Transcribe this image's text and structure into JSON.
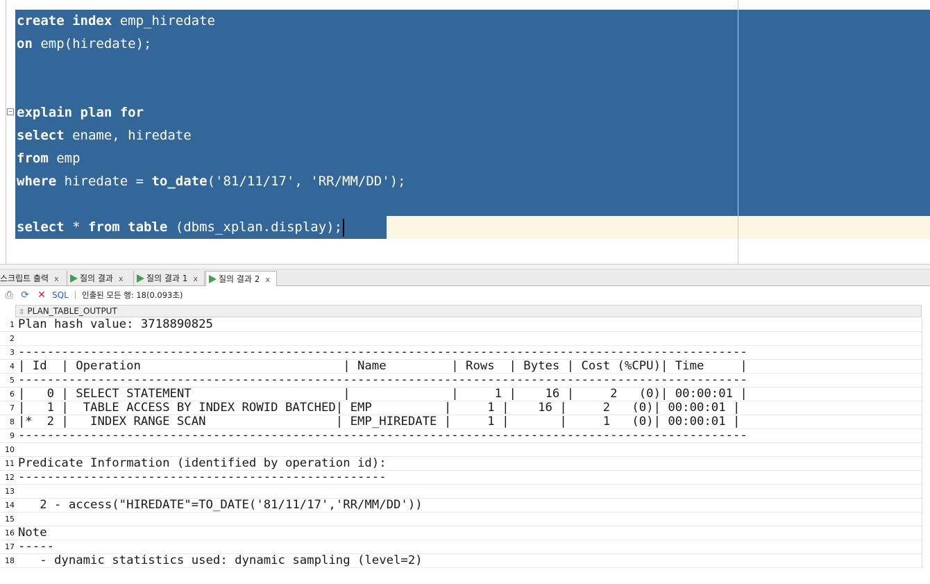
{
  "editor": {
    "lines": [
      [
        {
          "t": "create index",
          "k": true
        },
        {
          "t": " emp_hiredate",
          "k": false
        }
      ],
      [
        {
          "t": "on",
          "k": true
        },
        {
          "t": " emp(hiredate);",
          "k": false
        }
      ],
      [],
      [],
      [
        {
          "t": "explain plan for",
          "k": true
        }
      ],
      [
        {
          "t": "select",
          "k": true
        },
        {
          "t": " ename, hiredate",
          "k": false
        }
      ],
      [
        {
          "t": "from",
          "k": true
        },
        {
          "t": " emp",
          "k": false
        }
      ],
      [
        {
          "t": "where",
          "k": true
        },
        {
          "t": " hiredate = ",
          "k": false
        },
        {
          "t": "to_date",
          "k": true
        },
        {
          "t": "('81/11/17', 'RR/MM/DD');",
          "k": false
        }
      ],
      [],
      [
        {
          "t": "select",
          "k": true
        },
        {
          "t": " * ",
          "k": false
        },
        {
          "t": "from table",
          "k": true
        },
        {
          "t": " (dbms_xplan.display);",
          "k": false
        }
      ]
    ]
  },
  "tabs": [
    {
      "label": "스크립트 출력",
      "close": "x",
      "icon": false
    },
    {
      "label": "질의 결과",
      "close": "x",
      "icon": true
    },
    {
      "label": "질의 결과 1",
      "close": "x",
      "icon": true
    },
    {
      "label": "질의 결과 2",
      "close": "x",
      "icon": true,
      "active": true
    }
  ],
  "toolbar": {
    "print_icon": "printer-icon",
    "refresh_icon": "refresh-icon",
    "cancel_icon": "cancel-icon",
    "sql_label": "SQL",
    "status": "인출된 모든 행: 18(0.093초)"
  },
  "grid": {
    "column": "PLAN_TABLE_OUTPUT",
    "rows": [
      {
        "n": "1",
        "text": "Plan hash value: 3718890825"
      },
      {
        "n": "2",
        "text": ""
      },
      {
        "n": "3",
        "text": "-----------------------------------------------------------------------------------------------------"
      },
      {
        "n": "4",
        "text": "| Id  | Operation                            | Name         | Rows  | Bytes | Cost (%CPU)| Time     |"
      },
      {
        "n": "5",
        "text": "-----------------------------------------------------------------------------------------------------"
      },
      {
        "n": "6",
        "text": "|   0 | SELECT STATEMENT                     |              |     1 |    16 |     2   (0)| 00:00:01 |"
      },
      {
        "n": "7",
        "text": "|   1 |  TABLE ACCESS BY INDEX ROWID BATCHED| EMP          |     1 |    16 |     2   (0)| 00:00:01 |"
      },
      {
        "n": "8",
        "text": "|*  2 |   INDEX RANGE SCAN                  | EMP_HIREDATE |     1 |       |     1   (0)| 00:00:01 |"
      },
      {
        "n": "9",
        "text": "-----------------------------------------------------------------------------------------------------"
      },
      {
        "n": "10",
        "text": ""
      },
      {
        "n": "11",
        "text": "Predicate Information (identified by operation id):"
      },
      {
        "n": "12",
        "text": "---------------------------------------------------"
      },
      {
        "n": "13",
        "text": ""
      },
      {
        "n": "14",
        "text": "   2 - access(\"HIREDATE\"=TO_DATE('81/11/17','RR/MM/DD'))"
      },
      {
        "n": "15",
        "text": ""
      },
      {
        "n": "16",
        "text": "Note"
      },
      {
        "n": "17",
        "text": "-----"
      },
      {
        "n": "18",
        "text": "   - dynamic statistics used: dynamic sampling (level=2)"
      }
    ]
  }
}
